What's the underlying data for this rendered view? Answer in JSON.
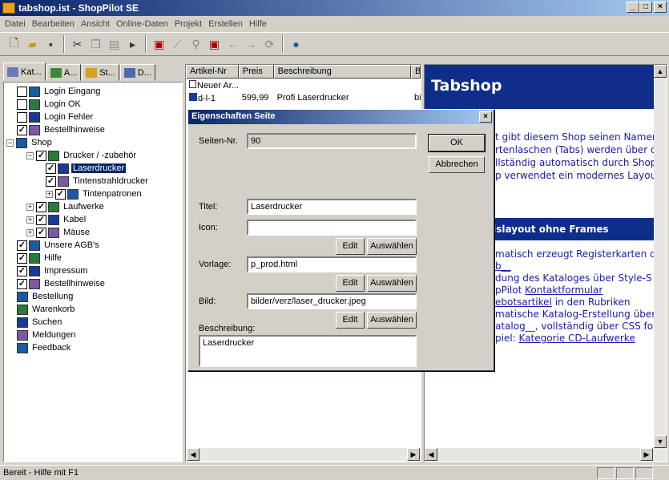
{
  "window": {
    "title": "tabshop.ist - ShopPilot SE",
    "controls": [
      "_",
      "□",
      "×"
    ]
  },
  "menu": [
    {
      "label": "Datei"
    },
    {
      "label": "Bearbeiten"
    },
    {
      "label": "Ansicht"
    },
    {
      "label": "Online-Daten"
    },
    {
      "label": "Projekt"
    },
    {
      "label": "Erstellen"
    },
    {
      "label": "Hilfe"
    }
  ],
  "toolbar": {
    "icons": [
      "new-icon",
      "open-icon",
      "save-icon",
      "cut-icon",
      "copy-icon",
      "paste-icon",
      "import-icon",
      "preview-icon",
      "wand-icon",
      "binoculars-icon",
      "preview2-icon",
      "back-icon",
      "forward-icon",
      "refresh-icon",
      "globe-icon"
    ]
  },
  "left_tabs": [
    {
      "label": "Kat..."
    },
    {
      "label": "A..."
    },
    {
      "label": "St..."
    },
    {
      "label": "D..."
    }
  ],
  "tree": [
    {
      "label": "Login Eingang",
      "level": 1,
      "checked": false
    },
    {
      "label": "Login OK",
      "level": 1,
      "checked": false
    },
    {
      "label": "Login Fehler",
      "level": 1,
      "checked": false
    },
    {
      "label": "Bestellhinweise",
      "level": 1,
      "checked": true
    },
    {
      "label": "Shop",
      "level": 0,
      "expander": "−"
    },
    {
      "label": "Drucker / -zubehör",
      "level": 2,
      "checked": true,
      "expander": "−"
    },
    {
      "label": "Laserdrucker",
      "level": 3,
      "checked": true,
      "selected": true
    },
    {
      "label": "Tintenstrahldrucker",
      "level": 3,
      "checked": true
    },
    {
      "label": "Tintenpatronen",
      "level": 3,
      "checked": true,
      "expander": "+"
    },
    {
      "label": "Laufwerke",
      "level": 2,
      "checked": true,
      "expander": "+"
    },
    {
      "label": "Kabel",
      "level": 2,
      "checked": true,
      "expander": "+"
    },
    {
      "label": "Mäuse",
      "level": 2,
      "checked": true,
      "expander": "+"
    },
    {
      "label": "Unsere AGB's",
      "level": 1,
      "checked": true
    },
    {
      "label": "Hilfe",
      "level": 1,
      "checked": true
    },
    {
      "label": "Impressum",
      "level": 1,
      "checked": true
    },
    {
      "label": "Bestellhinweise",
      "level": 1,
      "checked": true
    },
    {
      "label": "Bestellung",
      "level": 1
    },
    {
      "label": "Warenkorb",
      "level": 1
    },
    {
      "label": "Suchen",
      "level": 1
    },
    {
      "label": "Meldungen",
      "level": 1
    },
    {
      "label": "Feedback",
      "level": 1
    }
  ],
  "list": {
    "headers": [
      "Artikel-Nr",
      "Preis",
      "Beschreibung",
      "Bilc"
    ],
    "rows": [
      {
        "nr": "Neuer Ar...",
        "preis": "",
        "beschreibung": "",
        "bild": ""
      },
      {
        "nr": "d-l-1",
        "preis": "599,99",
        "beschreibung": "Profi Laserdrucker",
        "bild": "bilc"
      }
    ]
  },
  "preview": {
    "header": "Tabshop",
    "lines": [
      {
        "text": "t gibt diesem Shop seinen Namen"
      },
      {
        "text": "rtenlaschen (Tabs) werden über d"
      },
      {
        "text": "llständig automatisch durch Shop"
      },
      {
        "text": "p verwendet ein modernes Layou"
      }
    ],
    "section_title": "sislayout ohne Frames",
    "lines2": [
      {
        "pre": "matisch erzeugt Registerkarten du",
        "link": "",
        "post": ""
      },
      {
        "pre": "",
        "link": "b__",
        "post": ""
      },
      {
        "pre": "dung des Kataloges über Style-S",
        "link": "",
        "post": ""
      },
      {
        "pre": "pPilot ",
        "link": "Kontaktformular",
        "post": ""
      },
      {
        "pre": "",
        "link": "ebotsartikel",
        "post": " in den Rubriken"
      },
      {
        "pre": "matische Katalog-Erstellung über",
        "link": "",
        "post": ""
      },
      {
        "pre": "atalog__",
        "link": "",
        "post": ", vollständig über CSS for"
      },
      {
        "pre": "piel: ",
        "link": "Kategorie CD-Laufwerke",
        "post": ""
      }
    ]
  },
  "dialog": {
    "title": "Eigenschaften Seite",
    "seiten_nr_label": "Seiten-Nr.",
    "seiten_nr": "90",
    "ok_label": "OK",
    "cancel_label": "Abbrechen",
    "titel_label": "Titel:",
    "titel": "Laserdrucker",
    "icon_label": "Icon:",
    "icon": "",
    "edit_label": "Edit",
    "choose_label": "Auswählen",
    "vorlage_label": "Vorlage:",
    "vorlage": "p_prod.html",
    "bild_label": "Bild:",
    "bild": "bilder/verz/laser_drucker.jpeg",
    "beschreibung_label": "Beschreibung:",
    "beschreibung": "Laserdrucker"
  },
  "status": {
    "text": "Bereit - Hilfe mit F1"
  }
}
